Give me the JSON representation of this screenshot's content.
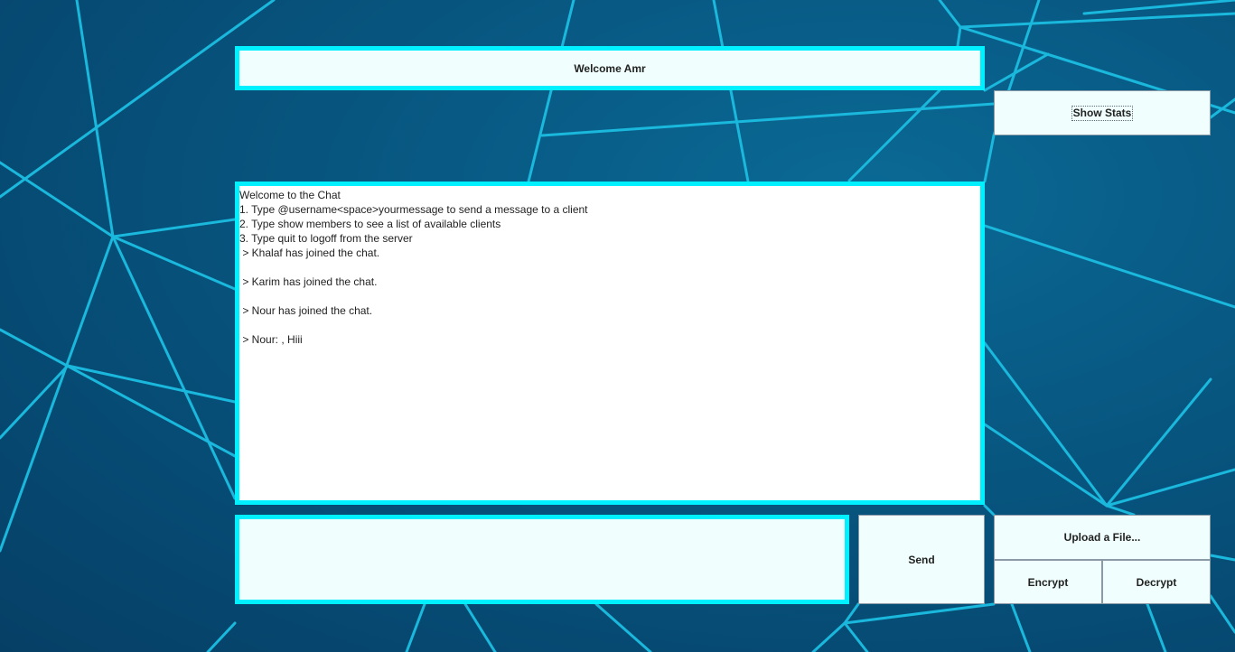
{
  "header": {
    "welcome_text": "Welcome Amr"
  },
  "toolbar": {
    "show_stats_label": "Show Stats"
  },
  "chat": {
    "lines": [
      "Welcome to the Chat",
      "1. Type @username<space>yourmessage to send a message to a client",
      "2. Type show members to see a list of available clients",
      "3. Type quit to logoff from the server",
      " > Khalaf has joined the chat.",
      "",
      " > Karim has joined the chat.",
      "",
      " > Nour has joined the chat.",
      "",
      " > Nour: , Hiii"
    ]
  },
  "composer": {
    "message_value": "",
    "send_label": "Send",
    "upload_label": "Upload a File...",
    "encrypt_label": "Encrypt",
    "decrypt_label": "Decrypt"
  },
  "colors": {
    "accent_border": "#00f0ff",
    "panel_bg": "#f0fffd",
    "background": "#07557f",
    "network_lines": "#1ab8dc"
  }
}
